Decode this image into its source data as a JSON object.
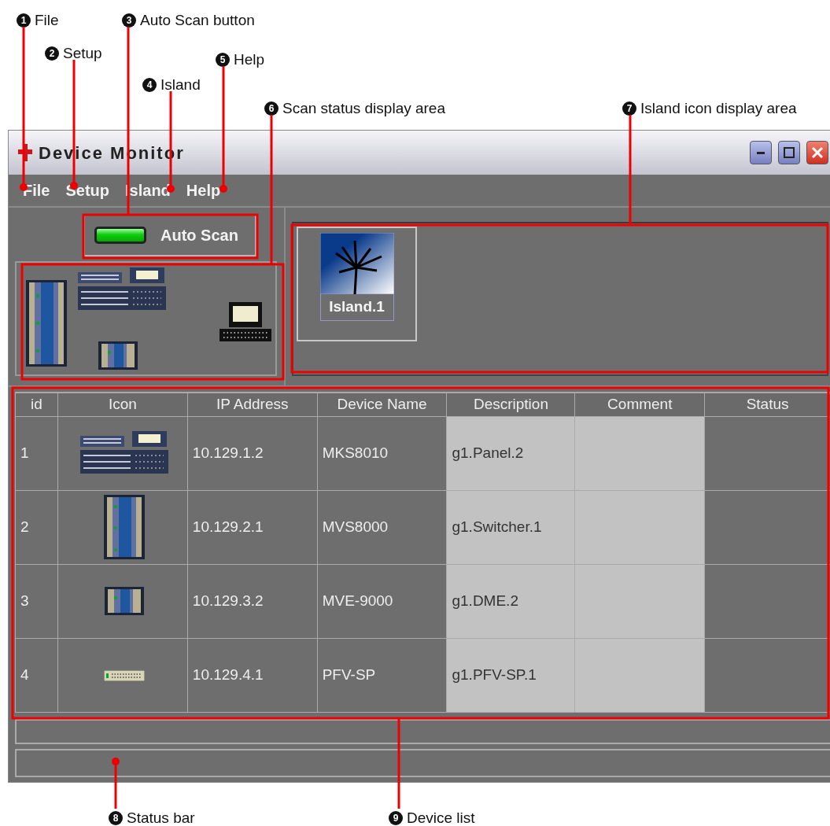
{
  "callouts": [
    {
      "number": "1",
      "label": "File"
    },
    {
      "number": "2",
      "label": "Setup"
    },
    {
      "number": "3",
      "label": "Auto Scan button"
    },
    {
      "number": "4",
      "label": "Island"
    },
    {
      "number": "5",
      "label": "Help"
    },
    {
      "number": "6",
      "label": "Scan status display area"
    },
    {
      "number": "7",
      "label": "Island icon display area"
    },
    {
      "number": "8",
      "label": "Status bar"
    },
    {
      "number": "9",
      "label": "Device list"
    }
  ],
  "window": {
    "title": "Device Monitor"
  },
  "menu": [
    "File",
    "Setup",
    "Island",
    "Help"
  ],
  "auto_scan": {
    "label": "Auto Scan",
    "on": true
  },
  "islands": [
    {
      "label": "Island.1"
    }
  ],
  "device_list": {
    "columns": [
      "id",
      "Icon",
      "IP Address",
      "Device Name",
      "Description",
      "Comment",
      "Status"
    ],
    "rows": [
      {
        "id": "1",
        "kind": "console",
        "ip_address": "10.129.1.2",
        "device_name": "MKS8010",
        "description": "g1.Panel.2"
      },
      {
        "id": "2",
        "kind": "rack",
        "ip_address": "10.129.2.1",
        "device_name": "MVS8000",
        "description": "g1.Switcher.1"
      },
      {
        "id": "3",
        "kind": "module",
        "ip_address": "10.129.3.2",
        "device_name": "MVE-9000",
        "description": "g1.DME.2"
      },
      {
        "id": "4",
        "kind": "strip",
        "ip_address": "10.129.4.1",
        "device_name": "PFV-SP",
        "description": "g1.PFV-SP.1"
      }
    ]
  }
}
